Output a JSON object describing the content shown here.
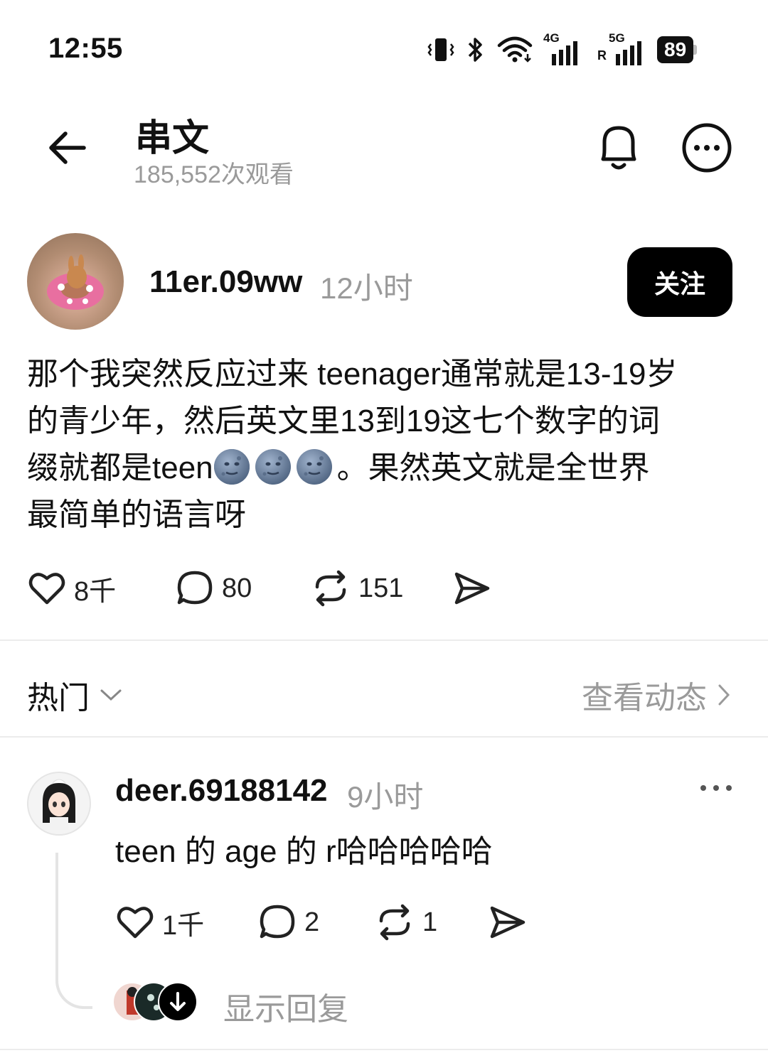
{
  "status_bar": {
    "time": "12:55",
    "network_1": "4G",
    "network_2": "5G",
    "roaming": "R",
    "battery": "89"
  },
  "header": {
    "title": "串文",
    "views": "185,552次观看"
  },
  "post": {
    "author": "11er.09ww",
    "time": "12小时",
    "follow_label": "关注",
    "text_line1": "那个我突然反应过来 teenager通常就是13-19岁",
    "text_line2": "的青少年，然后英文里13到19这七个数字的词",
    "text_line3_pre": "缀就都是teen",
    "text_line3_post": "。果然英文就是全世界",
    "text_line4": "最简单的语言呀",
    "emoji": [
      "new-moon-face",
      "new-moon-face",
      "new-moon-face"
    ],
    "likes": "8千",
    "comments": "80",
    "reposts": "151"
  },
  "sort_bar": {
    "label": "热门",
    "view_activity": "查看动态"
  },
  "comment": {
    "author": "deer.69188142",
    "time": "9小时",
    "text": "teen 的 age 的 r哈哈哈哈哈",
    "likes": "1千",
    "comments": "2",
    "reposts": "1",
    "show_replies": "显示回复"
  },
  "colors": {
    "text": "#111111",
    "muted": "#9a9a9a",
    "button_bg": "#000000",
    "divider": "#ececec"
  }
}
